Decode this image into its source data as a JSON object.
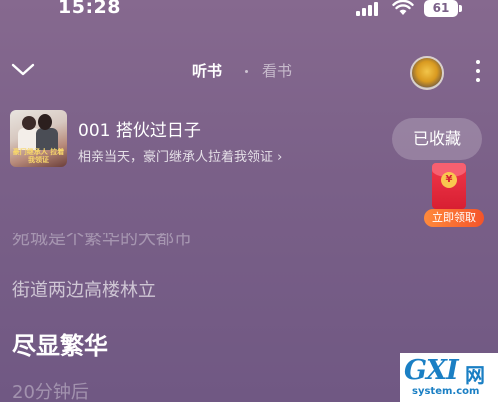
{
  "status_bar": {
    "time": "15:28",
    "battery": "61"
  },
  "nav": {
    "tabs": [
      {
        "label": "听书",
        "active": true
      },
      {
        "label": "看书",
        "active": false
      }
    ]
  },
  "book": {
    "cover_text": "豪门继承人 拉着我领证",
    "title": "001 搭伙过日子",
    "subtitle": "相亲当天，豪门继承人拉着我领证 ›",
    "collect_label": "已收藏"
  },
  "promo": {
    "coin_symbol": "¥",
    "label": "立即领取"
  },
  "lyrics": [
    "宛城是个繁华的大都市",
    "街道两边高楼林立",
    "尽显繁华",
    "20分钟后"
  ],
  "watermark": {
    "logo": "GXI",
    "cn": "网",
    "url": "system.com"
  },
  "colors": {
    "background": "#7a6088",
    "accent_red": "#d81f32",
    "watermark_blue": "#1a7fc4"
  }
}
